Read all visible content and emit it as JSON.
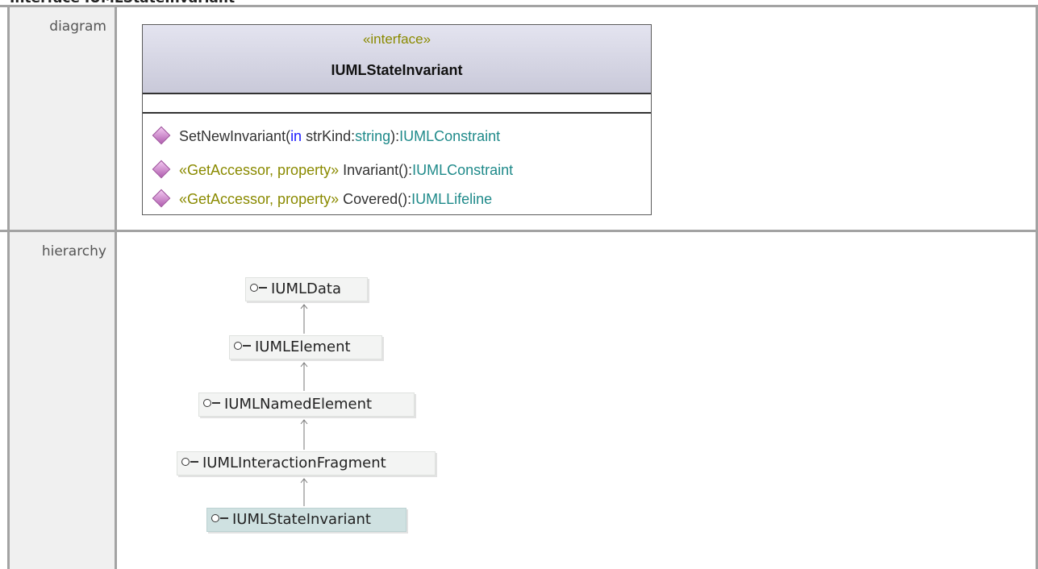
{
  "page": {
    "title": "Interface IUMLStateInvariant"
  },
  "rows": {
    "diagram_label": "diagram",
    "hierarchy_label": "hierarchy"
  },
  "uml_class": {
    "stereotype": "«interface»",
    "name": "IUMLStateInvariant",
    "operations": [
      {
        "parts": [
          {
            "text": "SetNewInvariant(",
            "style": "plain"
          },
          {
            "text": "in",
            "style": "kw"
          },
          {
            "text": " strKind:",
            "style": "plain"
          },
          {
            "text": "string",
            "style": "ty"
          },
          {
            "text": "):",
            "style": "plain"
          },
          {
            "text": "IUMLConstraint",
            "style": "ty"
          }
        ]
      },
      {
        "parts": [
          {
            "text": "«GetAccessor, property»",
            "style": "st"
          },
          {
            "text": " Invariant():",
            "style": "plain"
          },
          {
            "text": "IUMLConstraint",
            "style": "ty"
          }
        ]
      },
      {
        "parts": [
          {
            "text": "«GetAccessor, property»",
            "style": "st"
          },
          {
            "text": " Covered():",
            "style": "plain"
          },
          {
            "text": "IUMLLifeline",
            "style": "ty"
          }
        ]
      }
    ]
  },
  "hierarchy": [
    {
      "label": "IUMLData",
      "current": false
    },
    {
      "label": "IUMLElement",
      "current": false
    },
    {
      "label": "IUMLNamedElement",
      "current": false
    },
    {
      "label": "IUMLInteractionFragment",
      "current": false
    },
    {
      "label": "IUMLStateInvariant",
      "current": true
    }
  ],
  "colors": {
    "stereotype": "#8a8a00",
    "keyword": "#1a1aff",
    "type": "#1f8a8a",
    "current_node": "#cfe1e1",
    "operation_icon": "#c27bc0"
  }
}
